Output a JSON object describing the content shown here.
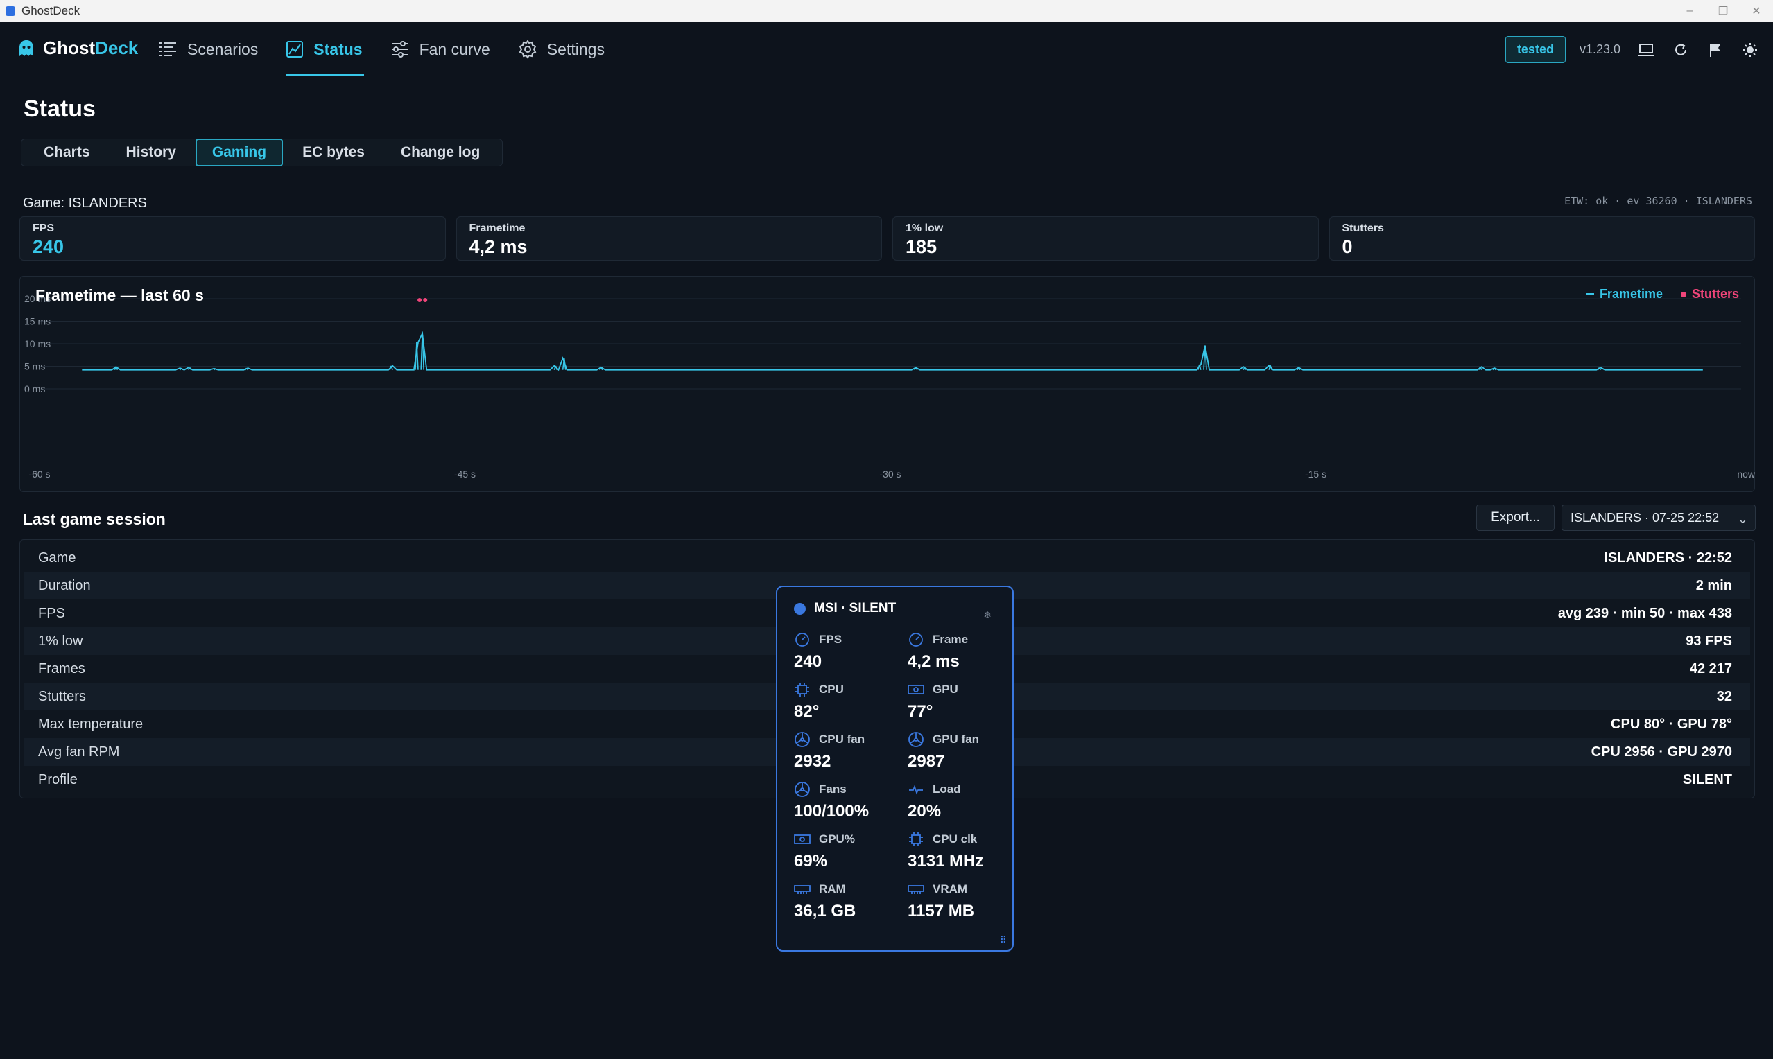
{
  "window": {
    "title": "GhostDeck"
  },
  "header": {
    "brand_prefix": "Ghost",
    "brand_suffix": "Deck",
    "nav": [
      {
        "label": "Scenarios",
        "icon": "list-icon"
      },
      {
        "label": "Status",
        "icon": "chart-icon",
        "active": true
      },
      {
        "label": "Fan curve",
        "icon": "sliders-icon"
      },
      {
        "label": "Settings",
        "icon": "gear-icon"
      }
    ],
    "badge": "tested",
    "version": "v1.23.0"
  },
  "page": {
    "title": "Status",
    "tabs": [
      "Charts",
      "History",
      "Gaming",
      "EC bytes",
      "Change log"
    ],
    "active_tab": "Gaming"
  },
  "game": {
    "label": "Game: ISLANDERS",
    "etw": "ETW: ok · ev 36260 · ISLANDERS"
  },
  "stats": [
    {
      "label": "FPS",
      "value": "240",
      "highlight": true
    },
    {
      "label": "Frametime",
      "value": "4,2 ms"
    },
    {
      "label": "1% low",
      "value": "185"
    },
    {
      "label": "Stutters",
      "value": "0"
    }
  ],
  "chart_data": {
    "type": "line",
    "title": "Frametime — last 60 s",
    "legend": [
      "Frametime",
      "Stutters"
    ],
    "legend_position": "top-right",
    "colors": {
      "frametime": "#38c6e8",
      "stutters": "#f0457a"
    },
    "xlim": [
      -60,
      0
    ],
    "ylim": [
      0,
      20
    ],
    "grid": true,
    "y_ticks": [
      "0 ms",
      "5 ms",
      "10 ms",
      "15 ms",
      "20 ms"
    ],
    "y_tick_values": [
      0,
      5,
      10,
      15,
      20
    ],
    "x_ticks": [
      "-60 s",
      "-45 s",
      "-30 s",
      "-15 s",
      "now"
    ],
    "x_tick_values": [
      -60,
      -45,
      -30,
      -15,
      0
    ],
    "series": [
      {
        "name": "Frametime",
        "baseline": 4.2,
        "x_end": -1.3,
        "spikes": [
          {
            "x": -57.3,
            "y": 4.9
          },
          {
            "x": -55.0,
            "y": 4.6
          },
          {
            "x": -54.7,
            "y": 4.7
          },
          {
            "x": -53.8,
            "y": 4.5
          },
          {
            "x": -52.7,
            "y": 4.6
          },
          {
            "x": -47.6,
            "y": 5.1
          },
          {
            "x": -46.7,
            "y": 10.3
          },
          {
            "x": -46.5,
            "y": 12.3
          },
          {
            "x": -41.8,
            "y": 5.1
          },
          {
            "x": -41.5,
            "y": 6.8
          },
          {
            "x": -40.2,
            "y": 4.8
          },
          {
            "x": -29.1,
            "y": 4.7
          },
          {
            "x": -19.1,
            "y": 5.4
          },
          {
            "x": -18.9,
            "y": 9.6
          },
          {
            "x": -17.5,
            "y": 4.9
          },
          {
            "x": -16.6,
            "y": 5.2
          },
          {
            "x": -15.6,
            "y": 4.7
          },
          {
            "x": -9.2,
            "y": 4.9
          },
          {
            "x": -8.7,
            "y": 4.6
          },
          {
            "x": -5.0,
            "y": 4.7
          }
        ]
      },
      {
        "name": "Stutters",
        "points": [
          {
            "x": -46.6,
            "y": 20
          },
          {
            "x": -46.4,
            "y": 20
          }
        ]
      }
    ]
  },
  "session": {
    "title": "Last game session",
    "export_label": "Export...",
    "selected": "ISLANDERS · 07-25 22:52",
    "rows": [
      {
        "key": "Game",
        "value": "ISLANDERS  ·  22:52"
      },
      {
        "key": "Duration",
        "value": "2 min"
      },
      {
        "key": "FPS",
        "value": "avg 239 · min 50 · max 438"
      },
      {
        "key": "1% low",
        "value": "93 FPS"
      },
      {
        "key": "Frames",
        "value": "42 217"
      },
      {
        "key": "Stutters",
        "value": "32"
      },
      {
        "key": "Max temperature",
        "value": "CPU 80°  ·  GPU 78°"
      },
      {
        "key": "Avg fan RPM",
        "value": "CPU 2956  ·  GPU 2970"
      },
      {
        "key": "Profile",
        "value": "SILENT"
      }
    ]
  },
  "overlay": {
    "title": "MSI · SILENT",
    "accent": "#3a78e0",
    "metrics": [
      {
        "label": "FPS",
        "value": "240",
        "icon": "gauge-icon"
      },
      {
        "label": "Frame",
        "value": "4,2 ms",
        "icon": "gauge-icon"
      },
      {
        "label": "CPU",
        "value": "82°",
        "icon": "cpu-icon"
      },
      {
        "label": "GPU",
        "value": "77°",
        "icon": "gpu-icon"
      },
      {
        "label": "CPU fan",
        "value": "2932",
        "icon": "fan-icon"
      },
      {
        "label": "GPU fan",
        "value": "2987",
        "icon": "fan-icon"
      },
      {
        "label": "Fans",
        "value": "100/100%",
        "icon": "fan-icon"
      },
      {
        "label": "Load",
        "value": "20%",
        "icon": "pulse-icon"
      },
      {
        "label": "GPU%",
        "value": "69%",
        "icon": "gpu-icon"
      },
      {
        "label": "CPU clk",
        "value": "3131 MHz",
        "icon": "cpu-icon"
      },
      {
        "label": "RAM",
        "value": "36,1 GB",
        "icon": "memory-icon"
      },
      {
        "label": "VRAM",
        "value": "1157 MB",
        "icon": "memory-icon"
      }
    ]
  }
}
